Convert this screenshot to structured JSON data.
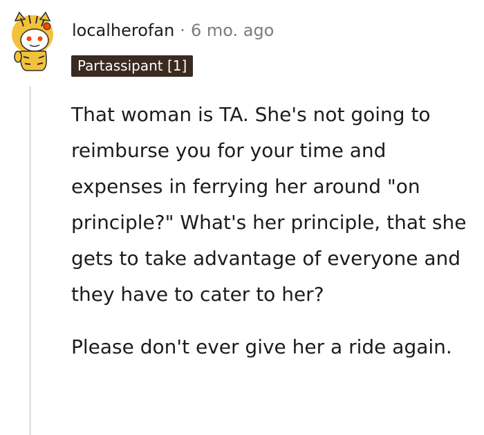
{
  "comment": {
    "username": "localherofan",
    "separator": "·",
    "timestamp": "6 mo. ago",
    "flair": "Partassipant [1]",
    "paragraphs": [
      "That woman is TA. She's not going to reimburse you for your time and expenses in ferrying her around \"on principle?\" What's her principle, that she gets to take advantage of everyone and they have to cater to her?",
      "Please don't ever give her a ride again."
    ]
  },
  "colors": {
    "username": "#1c1c1c",
    "meta": "#7c7c7c",
    "flair_bg": "#3a2a1f",
    "flair_text": "#ffffff",
    "thread_line": "#e5e5e5"
  },
  "icons": {
    "avatar": "snoo-tiger-costume-avatar"
  }
}
